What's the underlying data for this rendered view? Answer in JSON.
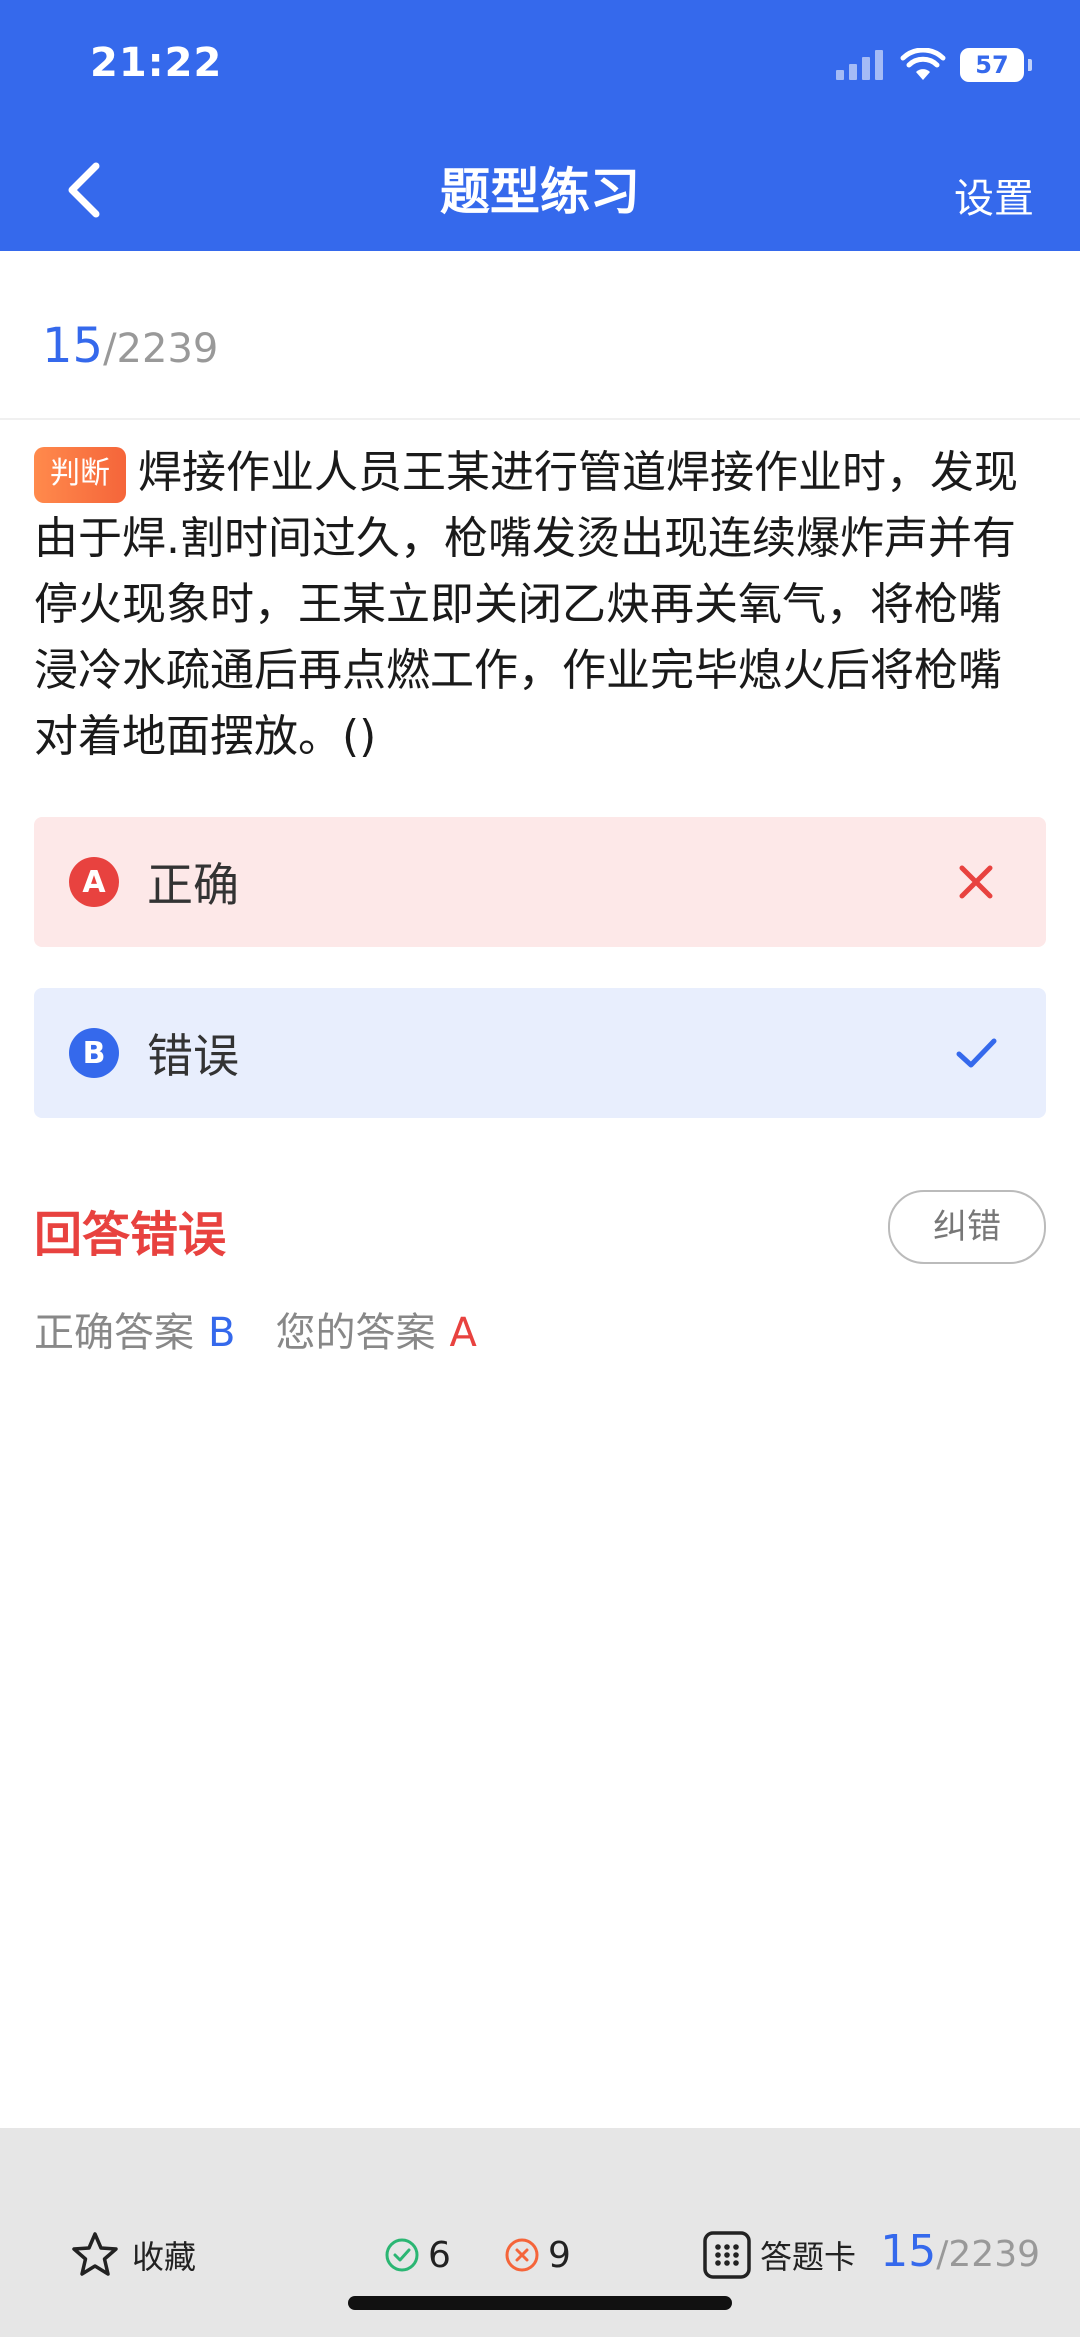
{
  "status_bar": {
    "time": "21:22",
    "battery": "57"
  },
  "nav": {
    "title": "题型练习",
    "settings_label": "设置"
  },
  "progress": {
    "current": "15",
    "total": "/2239"
  },
  "question": {
    "type_badge": "判断",
    "text": "焊接作业人员王某进行管道焊接作业时，发现由于焊.割时间过久，枪嘴发烫出现连续爆炸声并有停火现象时，王某立即关闭乙炔再关氧气，将枪嘴浸冷水疏通后再点燃工作，作业完毕熄火后将枪嘴对着地面摆放。()"
  },
  "options": [
    {
      "letter": "A",
      "text": "正确",
      "state": "wrong",
      "mark_icon": "close-icon"
    },
    {
      "letter": "B",
      "text": "错误",
      "state": "correct",
      "mark_icon": "check-icon"
    }
  ],
  "result": {
    "title": "回答错误",
    "report_button": "纠错",
    "correct_label": "正确答案",
    "correct_value": "B",
    "yours_label": "您的答案",
    "yours_value": "A"
  },
  "bottom_bar": {
    "favorite_label": "收藏",
    "right_count": "6",
    "wrong_count": "9",
    "answer_card_label": "答题卡",
    "progress_current": "15",
    "progress_total": "/2239"
  },
  "colors": {
    "brand": "#3569ec",
    "error": "#e8423f",
    "success": "#2bb673",
    "badge": "#f5653a"
  }
}
